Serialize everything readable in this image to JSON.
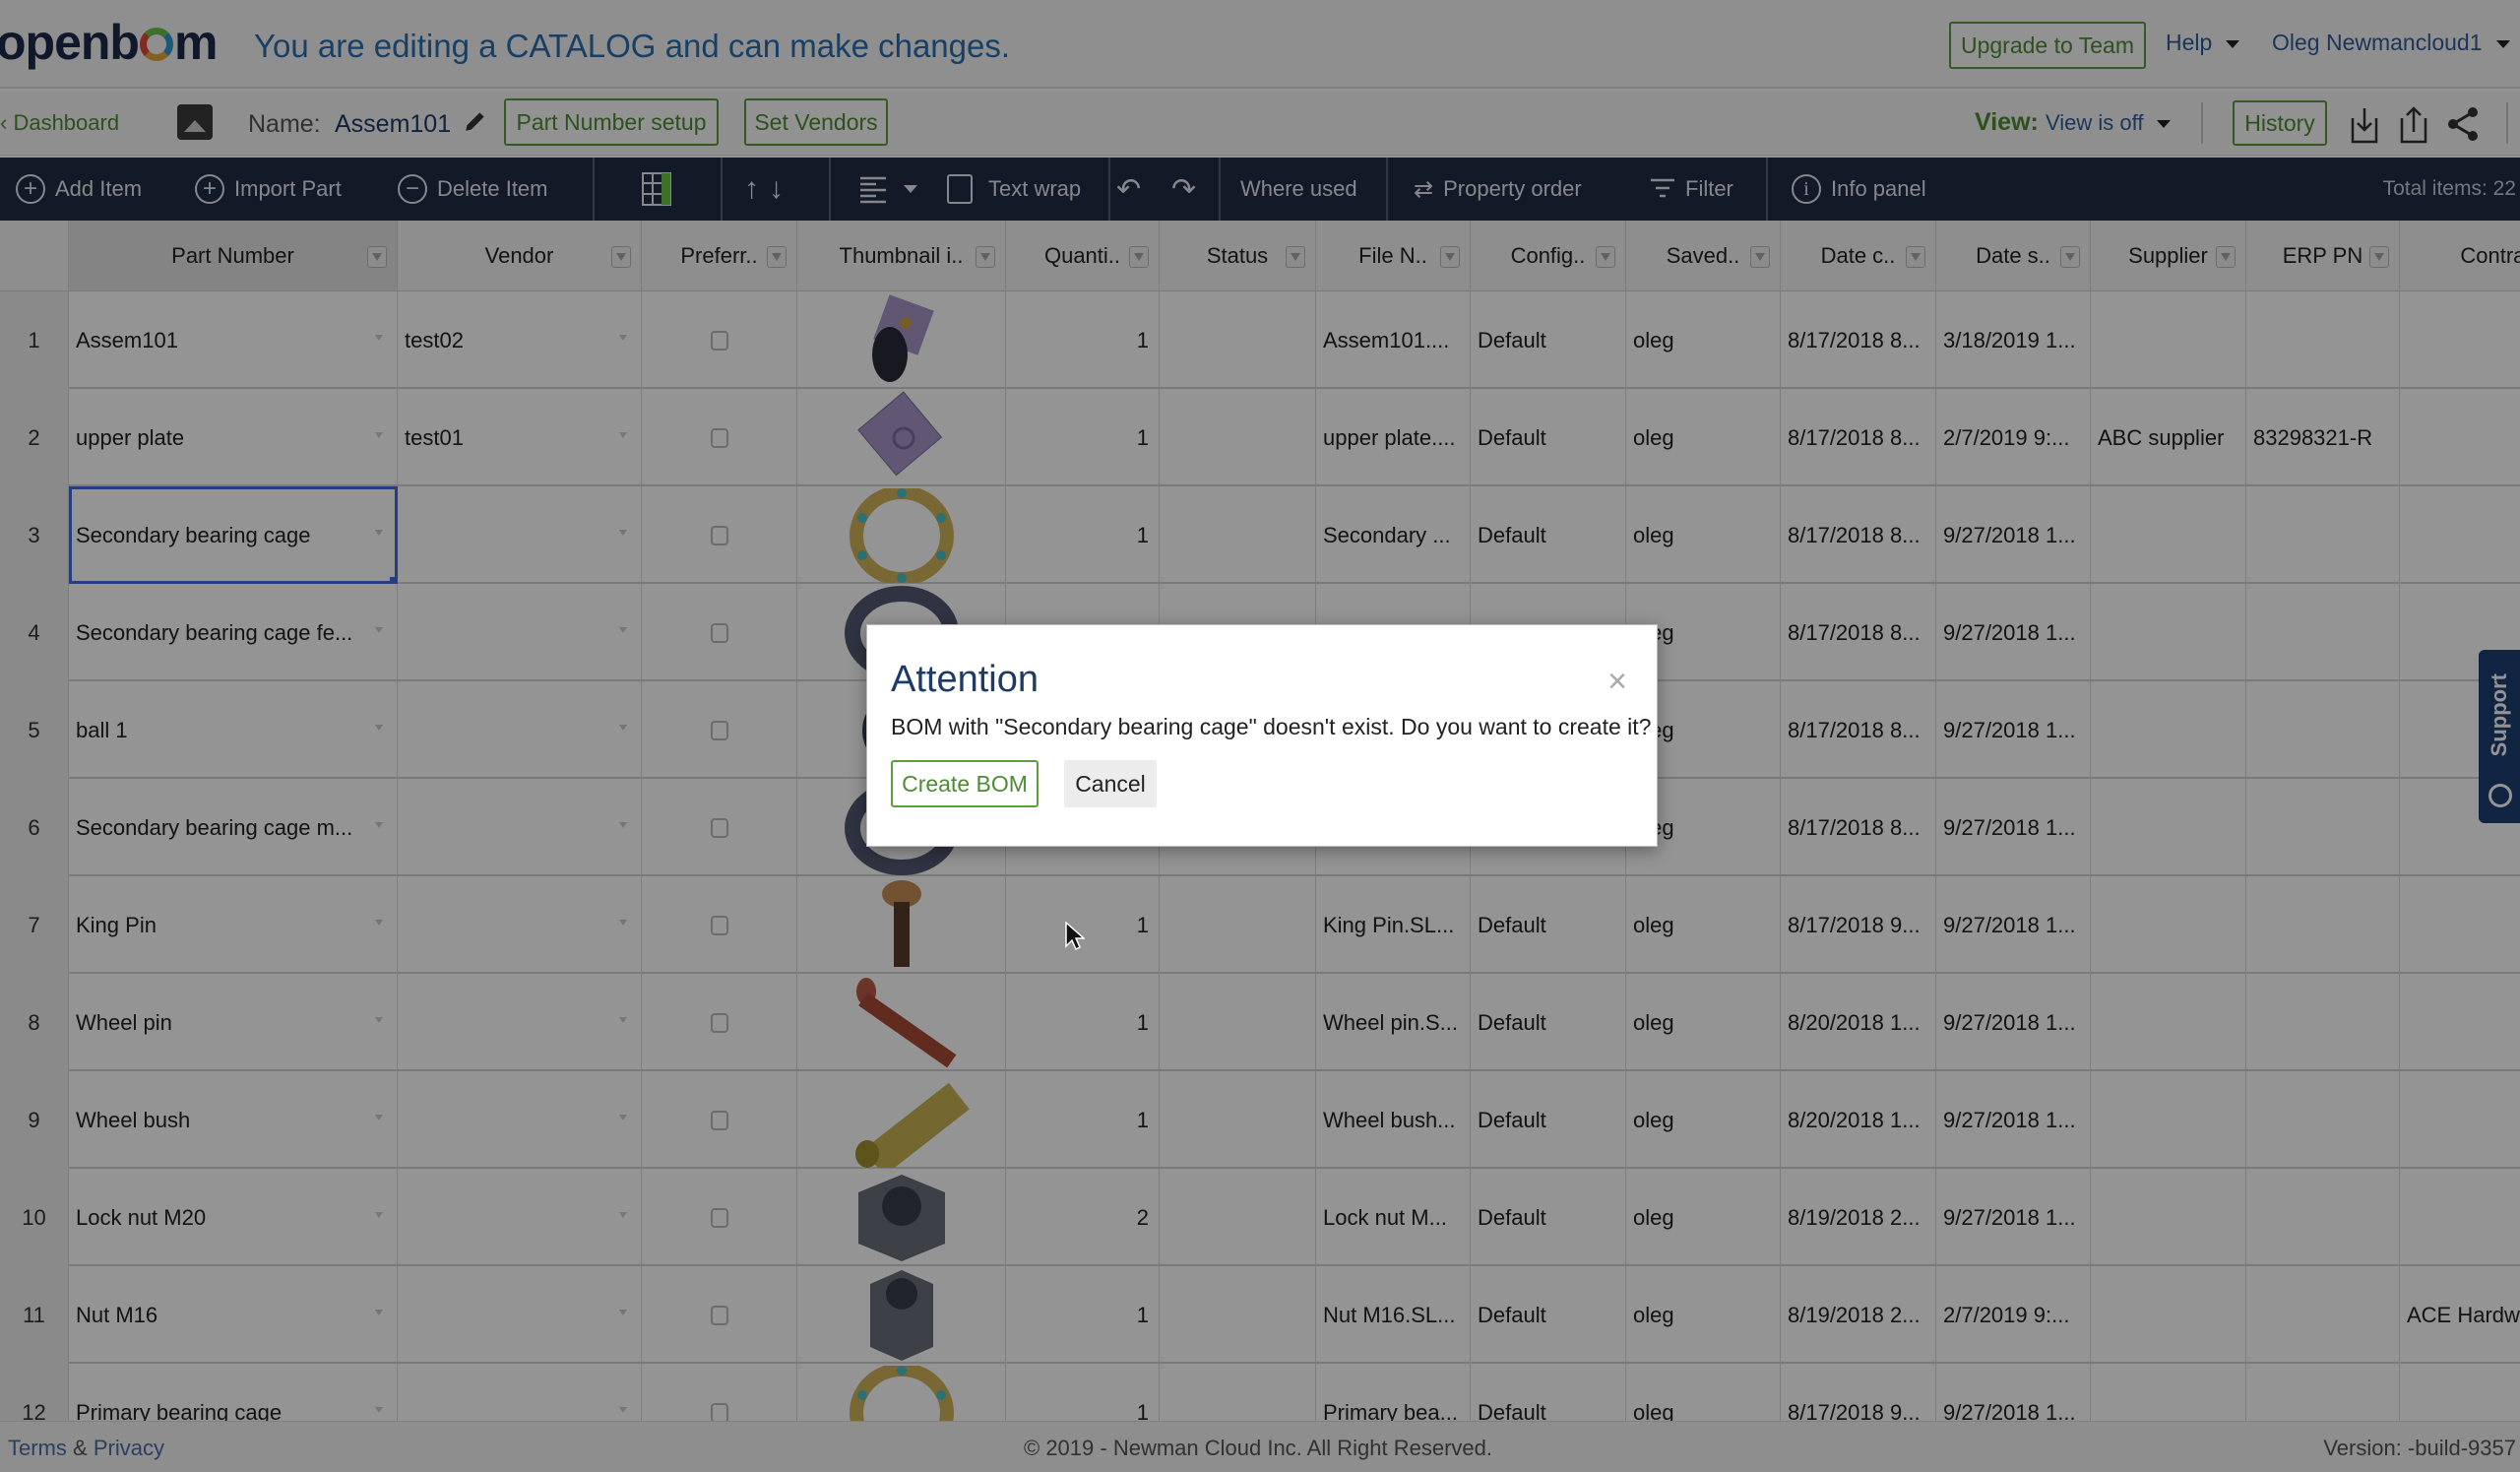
{
  "header": {
    "logo": "openb",
    "logo_tail": "m",
    "edit_message": "You are editing a CATALOG and can make changes.",
    "upgrade_label": "Upgrade to Team",
    "help_label": "Help",
    "user_label": "Oleg Newmancloud1"
  },
  "subbar": {
    "dashboard_label": "Dashboard",
    "name_label": "Name:",
    "name_value": "Assem101",
    "part_number_setup_label": "Part Number setup",
    "set_vendors_label": "Set Vendors",
    "view_label": "View:",
    "view_value": "View is off",
    "history_label": "History"
  },
  "toolbar": {
    "add_item": "Add Item",
    "import_part": "Import Part",
    "delete_item": "Delete Item",
    "text_wrap": "Text wrap",
    "where_used": "Where used",
    "property_order": "Property order",
    "filter": "Filter",
    "info_panel": "Info panel",
    "total_items": "Total items: 22"
  },
  "grid": {
    "columns": [
      "Part Number",
      "Vendor",
      "Preferr..",
      "Thumbnail i..",
      "Quanti..",
      "Status",
      "File N..",
      "Config..",
      "Saved..",
      "Date c..",
      "Date s..",
      "Supplier",
      "ERP PN",
      "Contra.."
    ],
    "rows": [
      {
        "n": "1",
        "part": "Assem101",
        "vendor": "test02",
        "thumb": "assembly",
        "qty": "1",
        "status": "",
        "file": "Assem101....",
        "config": "Default",
        "saved": "oleg",
        "date_c": "8/17/2018 8...",
        "date_s": "3/18/2019 1...",
        "supplier": "",
        "erp": "",
        "contra": ""
      },
      {
        "n": "2",
        "part": "upper plate",
        "vendor": "test01",
        "thumb": "plate",
        "qty": "1",
        "status": "",
        "file": "upper plate....",
        "config": "Default",
        "saved": "oleg",
        "date_c": "8/17/2018 8...",
        "date_s": "2/7/2019 9:...",
        "supplier": "ABC supplier",
        "erp": "83298321-R",
        "contra": ""
      },
      {
        "n": "3",
        "part": "Secondary bearing cage",
        "vendor": "",
        "thumb": "bearing-cage",
        "qty": "1",
        "status": "",
        "file": "Secondary ...",
        "config": "Default",
        "saved": "oleg",
        "date_c": "8/17/2018 8...",
        "date_s": "9/27/2018 1...",
        "supplier": "",
        "erp": "",
        "contra": ""
      },
      {
        "n": "4",
        "part": "Secondary bearing cage fe...",
        "vendor": "",
        "thumb": "flange-ring",
        "qty": "",
        "status": "",
        "file": "",
        "config": "",
        "saved": "oleg",
        "date_c": "8/17/2018 8...",
        "date_s": "9/27/2018 1...",
        "supplier": "",
        "erp": "",
        "contra": ""
      },
      {
        "n": "5",
        "part": "ball 1",
        "vendor": "",
        "thumb": "ball",
        "qty": "",
        "status": "",
        "file": "",
        "config": "",
        "saved": "oleg",
        "date_c": "8/17/2018 8...",
        "date_s": "9/27/2018 1...",
        "supplier": "",
        "erp": "",
        "contra": ""
      },
      {
        "n": "6",
        "part": "Secondary bearing cage m...",
        "vendor": "",
        "thumb": "flange-ring",
        "qty": "",
        "status": "",
        "file": "",
        "config": "",
        "saved": "oleg",
        "date_c": "8/17/2018 8...",
        "date_s": "9/27/2018 1...",
        "supplier": "",
        "erp": "",
        "contra": ""
      },
      {
        "n": "7",
        "part": "King Pin",
        "vendor": "",
        "thumb": "king-pin",
        "qty": "1",
        "status": "",
        "file": "King Pin.SL...",
        "config": "Default",
        "saved": "oleg",
        "date_c": "8/17/2018 9...",
        "date_s": "9/27/2018 1...",
        "supplier": "",
        "erp": "",
        "contra": ""
      },
      {
        "n": "8",
        "part": "Wheel pin",
        "vendor": "",
        "thumb": "wheel-pin",
        "qty": "1",
        "status": "",
        "file": "Wheel pin.S...",
        "config": "Default",
        "saved": "oleg",
        "date_c": "8/20/2018 1...",
        "date_s": "9/27/2018 1...",
        "supplier": "",
        "erp": "",
        "contra": ""
      },
      {
        "n": "9",
        "part": "Wheel bush",
        "vendor": "",
        "thumb": "bush",
        "qty": "1",
        "status": "",
        "file": "Wheel bush...",
        "config": "Default",
        "saved": "oleg",
        "date_c": "8/20/2018 1...",
        "date_s": "9/27/2018 1...",
        "supplier": "",
        "erp": "",
        "contra": ""
      },
      {
        "n": "10",
        "part": "Lock nut M20",
        "vendor": "",
        "thumb": "nut",
        "qty": "2",
        "status": "",
        "file": "Lock nut M...",
        "config": "Default",
        "saved": "oleg",
        "date_c": "8/19/2018 2...",
        "date_s": "9/27/2018 1...",
        "supplier": "",
        "erp": "",
        "contra": ""
      },
      {
        "n": "11",
        "part": "Nut M16",
        "vendor": "",
        "thumb": "nut-tall",
        "qty": "1",
        "status": "",
        "file": "Nut M16.SL...",
        "config": "Default",
        "saved": "oleg",
        "date_c": "8/19/2018 2...",
        "date_s": "2/7/2019 9:...",
        "supplier": "",
        "erp": "",
        "contra": "ACE Hardw"
      },
      {
        "n": "12",
        "part": "Primary bearing cage",
        "vendor": "",
        "thumb": "bearing-cage",
        "qty": "1",
        "status": "",
        "file": "Primary bea...",
        "config": "Default",
        "saved": "oleg",
        "date_c": "8/17/2018 9...",
        "date_s": "9/27/2018 1...",
        "supplier": "",
        "erp": "",
        "contra": ""
      }
    ]
  },
  "footer": {
    "terms": "Terms",
    "amp": "&",
    "privacy": "Privacy",
    "copyright": "© 2019 - Newman Cloud Inc. All Right Reserved.",
    "version": "Version: -build-9357"
  },
  "support": {
    "label": "Support"
  },
  "dialog": {
    "title": "Attention",
    "message": "BOM with \"Secondary bearing cage\" doesn't exist. Do you want to create it?",
    "create_label": "Create BOM",
    "cancel_label": "Cancel",
    "close_glyph": "×"
  },
  "colors": {
    "accent_green": "#4c8c33",
    "toolbar_bg": "#1f2b44",
    "link_blue": "#2f5d99",
    "selection_blue": "#3d6fd6",
    "support_bg": "#1e3f73"
  }
}
